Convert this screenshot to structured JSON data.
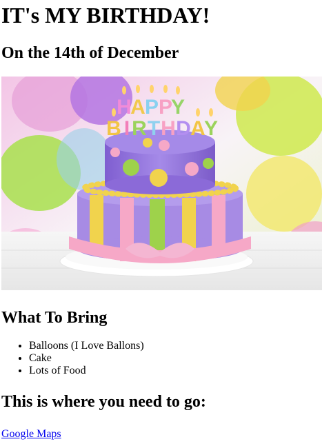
{
  "page": {
    "title": "IT's MY BIRTHDAY!",
    "date_heading": "On the 14th of December",
    "bring_heading": "What To Bring",
    "bring_items": [
      "Balloons (I Love Ballons)",
      "Cake",
      "Lots of Food"
    ],
    "go_heading": "This is where you need to go:",
    "maps_link": "Google Maps"
  },
  "image": {
    "cake_candles_text": "HAPPY BIRTHDAY"
  },
  "colors": {
    "link": "#0000ee",
    "cake_purple": "#9b79d8",
    "cake_yellow": "#f1d34d",
    "cake_pink": "#f6a8c7",
    "cake_green": "#9ed24b"
  }
}
